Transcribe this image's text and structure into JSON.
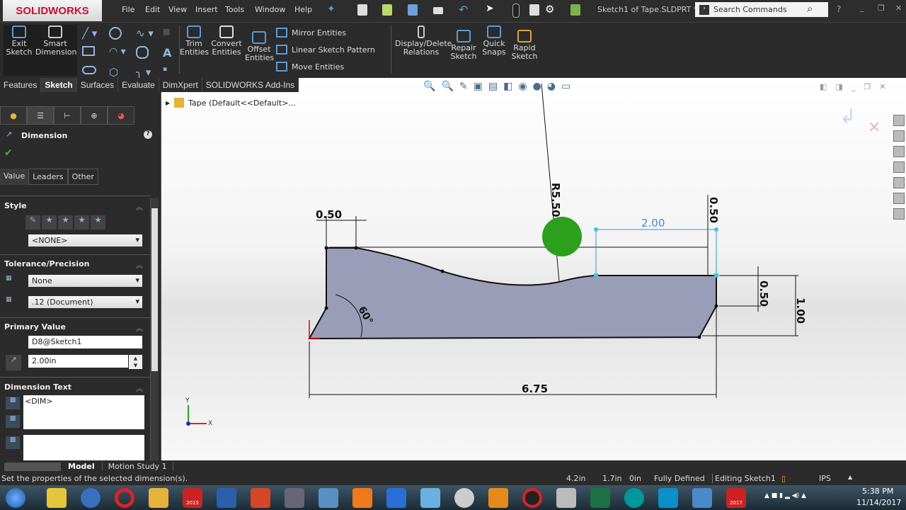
{
  "app": {
    "logo": "SOLIDWORKS",
    "document_title": "Sketch1 of Tape.SLDPRT *",
    "search_placeholder": "Search Commands"
  },
  "menu": [
    "File",
    "Edit",
    "View",
    "Insert",
    "Tools",
    "Window",
    "Help"
  ],
  "ribbon": {
    "exit_sketch": "Exit Sketch",
    "smart_dimension": "Smart Dimension",
    "trim": "Trim Entities",
    "convert": "Convert Entities",
    "offset": "Offset Entities",
    "mirror": "Mirror Entities",
    "linear_pattern": "Linear Sketch Pattern",
    "move": "Move Entities",
    "display_relations": "Display/Delete Relations",
    "repair": "Repair Sketch",
    "quick_snaps": "Quick Snaps",
    "rapid_sketch": "Rapid Sketch"
  },
  "tabs": [
    "Features",
    "Sketch",
    "Surfaces",
    "Evaluate",
    "DimXpert",
    "SOLIDWORKS Add-Ins"
  ],
  "active_tab": "Sketch",
  "tree": {
    "root": "Tape  (Default<<Default>..."
  },
  "property_manager": {
    "title": "Dimension",
    "subtabs": [
      "Value",
      "Leaders",
      "Other"
    ],
    "style": {
      "label": "Style",
      "value": "<NONE>"
    },
    "tolerance": {
      "label": "Tolerance/Precision",
      "tolerance": "None",
      "precision": ".12 (Document)"
    },
    "primary": {
      "label": "Primary Value",
      "name": "D8@Sketch1",
      "value": "2.00in"
    },
    "dim_text": {
      "label": "Dimension Text",
      "value": "<DIM>"
    }
  },
  "sketch": {
    "dims": {
      "top_left": "0.50",
      "radius": "R5.50",
      "selected": "2.00",
      "top_right": "0.50",
      "right_small": "0.50",
      "right_total": "1.00",
      "angle": "60°",
      "overall": "6.75"
    },
    "axis_x": "X",
    "axis_y": "Y",
    "selected_color": "#3b8fe0",
    "shape_fill": "#9a9db8"
  },
  "bottom_tabs": [
    "Model",
    "Motion Study 1"
  ],
  "status": {
    "message": "Set the properties of the selected dimension(s).",
    "x": "4.2in",
    "y": "1.7in",
    "z": "0in",
    "state": "Fully Defined",
    "mode": "Editing Sketch1",
    "units": "IPS"
  },
  "taskbar": {
    "time": "5:38 PM",
    "date": "11/14/2017",
    "sw2015": "2015",
    "sw2017": "2017"
  }
}
